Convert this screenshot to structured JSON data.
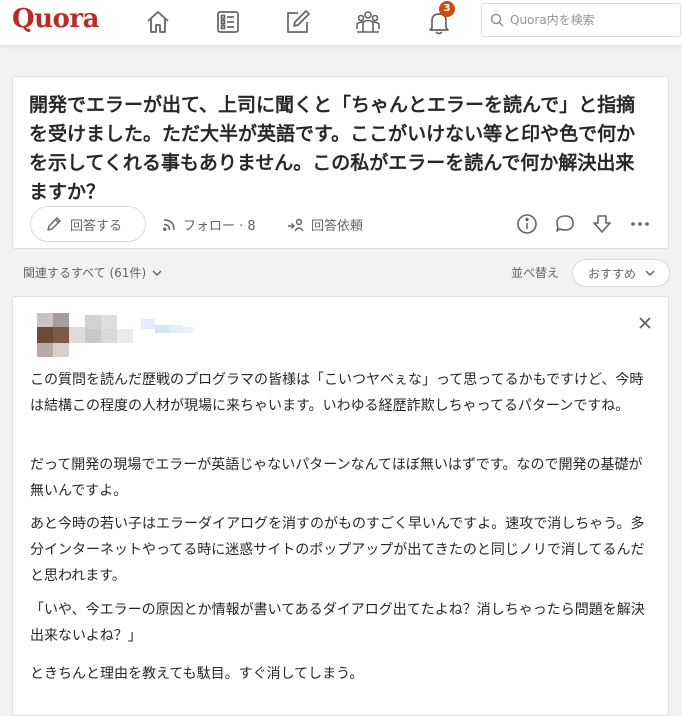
{
  "nav": {
    "logo": "Quora",
    "notification_count": "3",
    "search_placeholder": "Quora内を検索",
    "icons": [
      "home-icon",
      "following-icon",
      "answer-icon",
      "spaces-icon",
      "notifications-icon",
      "search-icon"
    ]
  },
  "question": {
    "title": "開発でエラーが出て、上司に聞くと「ちゃんとエラーを読んで」と指摘を受けました。ただ大半が英語です。ここがいけない等と印や色で何かを示してくれる事もありません。この私がエラーを読んで何か解決出来ますか？",
    "answer_label": "回答する",
    "follow_label": "フォロー · 8",
    "request_label": "回答依頼"
  },
  "related": {
    "label": "関連するすべて (61件)",
    "sort_label": "並べ替え",
    "sort_value": "おすすめ"
  },
  "answer": {
    "paragraphs": [
      "この質問を読んだ歴戦のプログラマの皆様は「こいつヤベぇな」って思ってるかもですけど、今時は結構この程度の人材が現場に来ちゃいます。いわゆる経歴詐欺しちゃってるパターンですね。",
      "だって開発の現場でエラーが英語じゃないパターンなんてほぼ無いはずです。なので開発の基礎が無いんですよ。",
      "あと今時の若い子はエラーダイアログを消すのがものすごく早いんですよ。速攻で消しちゃう。多分インターネットやってる時に迷惑サイトのポップアップが出てきたのと同じノリで消してるんだと思われます。",
      "「いや、今エラーの原因とか情報が書いてあるダイアログ出てたよね？消しちゃったら問題を解決出来ないよね？」",
      "ときちんと理由を教えても駄目。すぐ消してしまう。"
    ]
  },
  "colors": {
    "brand": "#b92b27",
    "badge": "#cb4b10",
    "text": "#282829",
    "muted": "#636466",
    "background": "#f1f2f2"
  }
}
